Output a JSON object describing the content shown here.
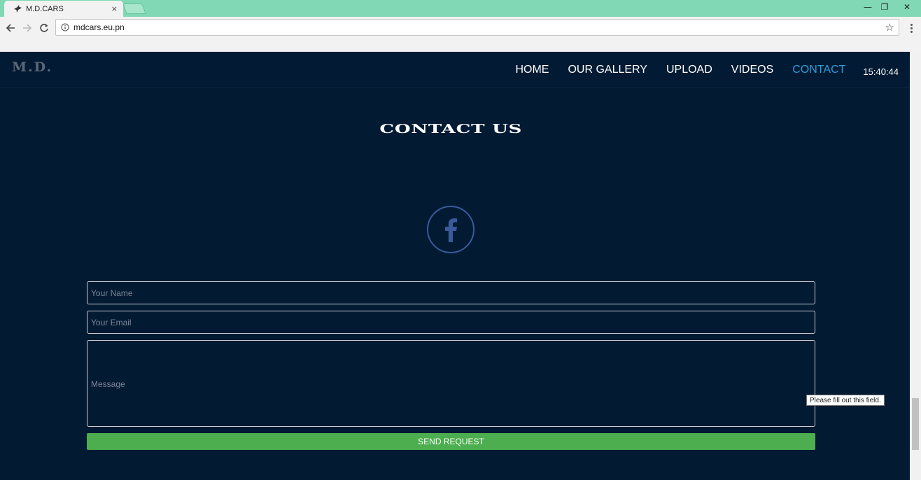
{
  "browser": {
    "tab_title": "M.D.CARS",
    "tab_close": "×",
    "url": "mdcars.eu.pn",
    "minimize": "—",
    "restore": "❐",
    "close": "✕",
    "star": "☆"
  },
  "site": {
    "logo": "M.D.",
    "nav": [
      {
        "label": "HOME"
      },
      {
        "label": "OUR GALLERY"
      },
      {
        "label": "UPLOAD"
      },
      {
        "label": "VIDEOS"
      },
      {
        "label": "CONTACT"
      }
    ],
    "clock": "15:40:44",
    "active_color": "#2e9ed9"
  },
  "contact": {
    "title": "CONTACT US",
    "social_icon": "facebook-icon",
    "name_placeholder": "Your Name",
    "email_placeholder": "Your Email",
    "message_placeholder": "Message",
    "send_label": "SEND REQUEST",
    "tooltip": "Please fill out this field."
  },
  "colors": {
    "page_bg": "#031a33",
    "button_green": "#4cae4f",
    "tabbar": "#80d8b4",
    "facebook_blue": "#3a5a9c"
  }
}
